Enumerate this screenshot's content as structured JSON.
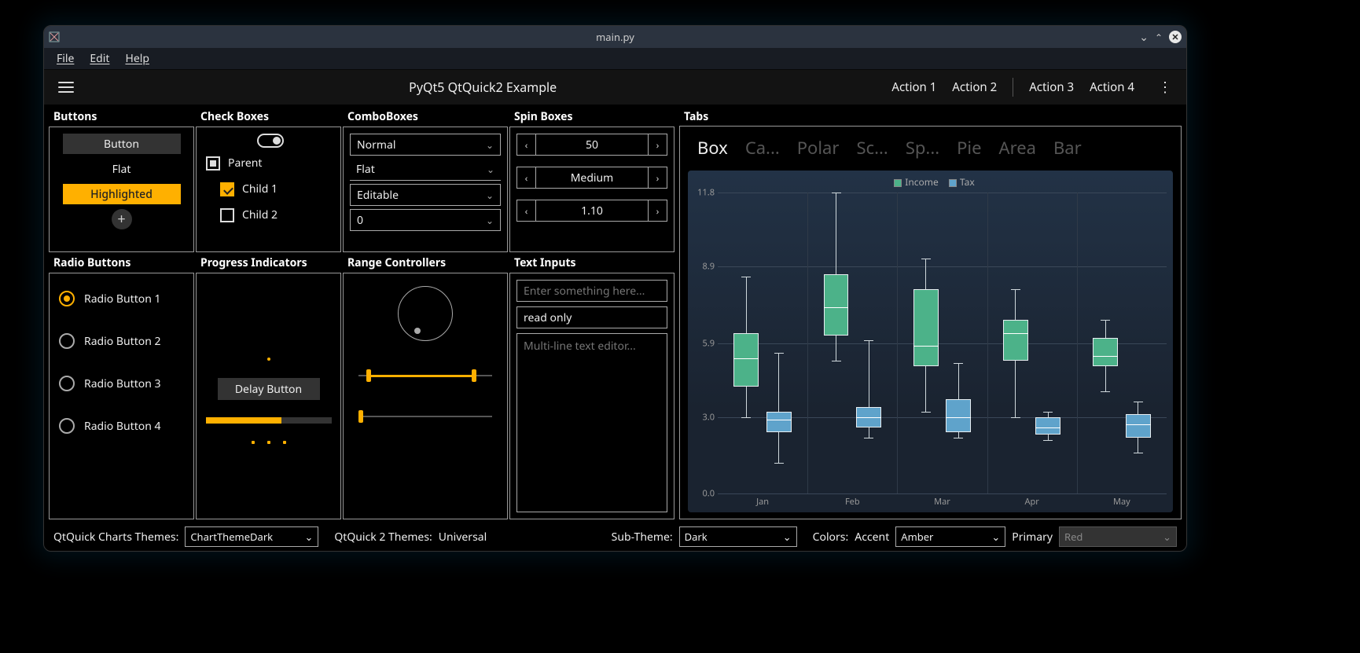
{
  "window": {
    "title": "main.py"
  },
  "menubar": {
    "file": "File",
    "edit": "Edit",
    "help": "Help"
  },
  "actionbar": {
    "heading": "PyQt5 QtQuick2 Example",
    "actions": [
      "Action 1",
      "Action 2",
      "Action 3",
      "Action 4"
    ]
  },
  "sections": {
    "buttons": "Buttons",
    "checkboxes": "Check Boxes",
    "comboboxes": "ComboBoxes",
    "spinboxes": "Spin Boxes",
    "tabs": "Tabs",
    "radiobuttons": "Radio Buttons",
    "progress": "Progress Indicators",
    "range": "Range Controllers",
    "textinputs": "Text Inputs"
  },
  "buttons": {
    "button": "Button",
    "flat": "Flat",
    "highlighted": "Highlighted",
    "round": "+"
  },
  "checkboxes": {
    "parent": "Parent",
    "child1": "Child 1",
    "child2": "Child 2",
    "parent_state": "indeterminate",
    "child1_checked": true,
    "child2_checked": false
  },
  "comboboxes": {
    "normal": "Normal",
    "flat": "Flat",
    "editable": "Editable",
    "number": "0"
  },
  "spinboxes": {
    "int": "50",
    "enum": "Medium",
    "float": "1.10"
  },
  "radiobuttons": {
    "items": [
      "Radio Button 1",
      "Radio Button 2",
      "Radio Button 3",
      "Radio Button 4"
    ],
    "selected": 0
  },
  "progress": {
    "delay_button": "Delay Button",
    "bar_percent": 60
  },
  "textinputs": {
    "placeholder": "Enter something here...",
    "readonly": "read only",
    "multiline_placeholder": "Multi-line text editor..."
  },
  "tabs": {
    "items": [
      "Box",
      "Ca...",
      "Polar",
      "Sc...",
      "Sp...",
      "Pie",
      "Area",
      "Bar"
    ],
    "active": 0
  },
  "chart_data": {
    "type": "box",
    "title": "",
    "legend": [
      "Income",
      "Tax"
    ],
    "categories": [
      "Jan",
      "Feb",
      "Mar",
      "Apr",
      "May"
    ],
    "ylim": [
      0.0,
      11.8
    ],
    "yticks": [
      0.0,
      3.0,
      5.9,
      8.9,
      11.8
    ],
    "series": [
      {
        "name": "Income",
        "color": "#4cb289",
        "boxes": [
          {
            "low": 3.0,
            "q1": 4.2,
            "med": 5.3,
            "q3": 6.3,
            "high": 8.5
          },
          {
            "low": 5.2,
            "q1": 6.2,
            "med": 7.3,
            "q3": 8.6,
            "high": 11.8
          },
          {
            "low": 3.2,
            "q1": 5.0,
            "med": 5.8,
            "q3": 8.0,
            "high": 9.2
          },
          {
            "low": 3.0,
            "q1": 5.2,
            "med": 6.3,
            "q3": 6.8,
            "high": 8.0
          },
          {
            "low": 4.0,
            "q1": 5.0,
            "med": 5.4,
            "q3": 6.1,
            "high": 6.8
          }
        ]
      },
      {
        "name": "Tax",
        "color": "#5fa3cb",
        "boxes": [
          {
            "low": 1.2,
            "q1": 2.4,
            "med": 2.9,
            "q3": 3.2,
            "high": 5.5
          },
          {
            "low": 2.2,
            "q1": 2.6,
            "med": 3.0,
            "q3": 3.4,
            "high": 6.0
          },
          {
            "low": 2.2,
            "q1": 2.4,
            "med": 3.0,
            "q3": 3.7,
            "high": 5.1
          },
          {
            "low": 2.1,
            "q1": 2.3,
            "med": 2.6,
            "q3": 3.0,
            "high": 3.2
          },
          {
            "low": 1.6,
            "q1": 2.2,
            "med": 2.7,
            "q3": 3.1,
            "high": 3.6
          }
        ]
      }
    ]
  },
  "footer": {
    "charts_themes_label": "QtQuick Charts Themes:",
    "charts_theme": "ChartThemeDark",
    "qtquick2_themes_label": "QtQuick 2 Themes:",
    "qtquick2_theme": "Universal",
    "sub_theme_label": "Sub-Theme:",
    "sub_theme": "Dark",
    "colors_label": "Colors:",
    "accent_label": "Accent",
    "accent": "Amber",
    "primary_label": "Primary",
    "primary": "Red"
  }
}
